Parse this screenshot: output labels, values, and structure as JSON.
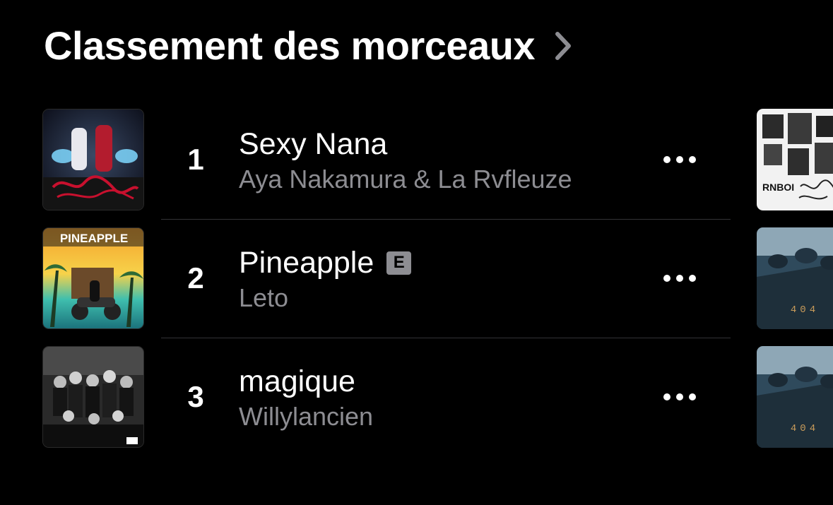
{
  "section": {
    "title": "Classement des morceaux",
    "chevron_icon": "chevron-right-icon"
  },
  "colors": {
    "background": "#000000",
    "primary_text": "#ffffff",
    "secondary_text": "#8d8d92",
    "divider": "#333336"
  },
  "tracks": [
    {
      "rank": "1",
      "title": "Sexy Nana",
      "artist": "Aya Nakamura & La Rvfleuze",
      "explicit": false,
      "more_icon": "ellipsis-icon"
    },
    {
      "rank": "2",
      "title": "Pineapple",
      "artist": "Leto",
      "explicit": true,
      "explicit_label": "E",
      "artwork_text": "PINEAPPLE",
      "more_icon": "ellipsis-icon"
    },
    {
      "rank": "3",
      "title": "magique",
      "artist": "Willylancien",
      "explicit": false,
      "more_icon": "ellipsis-icon"
    }
  ],
  "next_column_artwork": [
    {
      "artwork_text": "RNBOI"
    },
    {
      "artwork_text": "404"
    },
    {
      "artwork_text": "404"
    }
  ]
}
